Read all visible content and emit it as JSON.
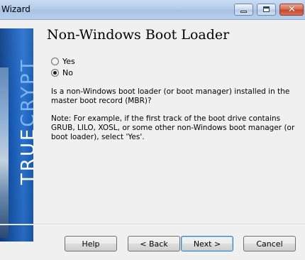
{
  "window": {
    "title": "Wizard"
  },
  "banner": {
    "text_part1": "TRUE",
    "text_part2": "CRYPT"
  },
  "page": {
    "heading": "Non-Windows Boot Loader",
    "options": [
      {
        "label": "Yes",
        "checked": false
      },
      {
        "label": "No",
        "checked": true
      }
    ],
    "question": "Is a non-Windows boot loader (or boot manager) installed in the master boot record (MBR)?",
    "note": "Note: For example, if the first track of the boot drive contains GRUB, LILO, XOSL, or some other non-Windows boot manager (or boot loader), select 'Yes'."
  },
  "buttons": {
    "help": "Help",
    "back": "< Back",
    "next": "Next >",
    "cancel": "Cancel"
  },
  "icons": {
    "minimize": "minimize-icon",
    "maximize": "maximize-icon",
    "close": "close-icon"
  },
  "colors": {
    "banner_blue": "#1b5db6",
    "banner_text_light": "#7fb4ee",
    "close_red": "#c2462d"
  }
}
